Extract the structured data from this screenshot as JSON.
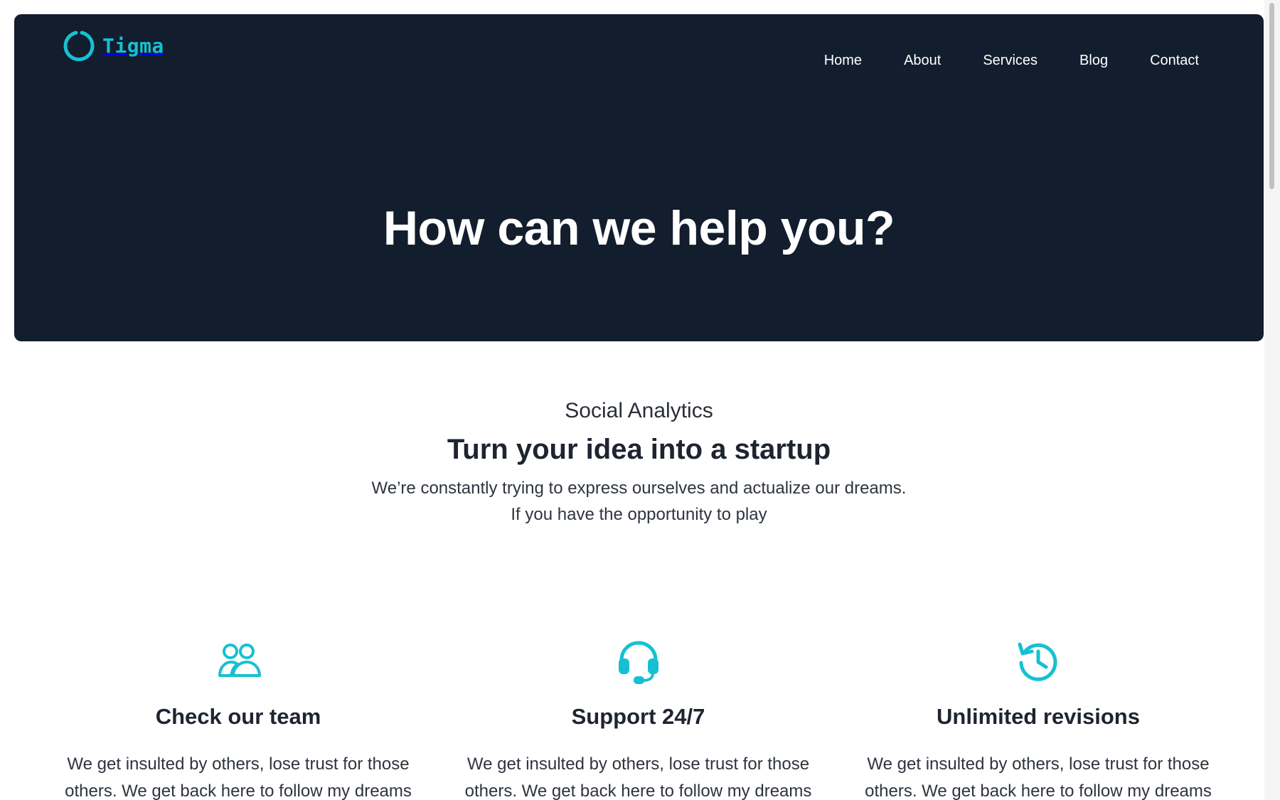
{
  "brand": {
    "name": "Tigma",
    "accent_color": "#16c0d2",
    "hero_bg_color": "#121d2d"
  },
  "nav": {
    "items": [
      {
        "label": "Home"
      },
      {
        "label": "About"
      },
      {
        "label": "Services"
      },
      {
        "label": "Blog"
      },
      {
        "label": "Contact"
      }
    ]
  },
  "hero": {
    "title": "How can we help you?"
  },
  "intro": {
    "eyebrow": "Social Analytics",
    "heading": "Turn your idea into a startup",
    "line1": "We’re constantly trying to express ourselves and actualize our dreams.",
    "line2": "If you have the opportunity to play"
  },
  "features": [
    {
      "icon": "users-icon",
      "title": "Check our team",
      "text_line1": "We get insulted by others, lose trust for those",
      "text_line2": "others. We get back here to follow my dreams"
    },
    {
      "icon": "headset-icon",
      "title": "Support 24/7",
      "text_line1": "We get insulted by others, lose trust for those",
      "text_line2": "others. We get back here to follow my dreams"
    },
    {
      "icon": "history-icon",
      "title": "Unlimited revisions",
      "text_line1": "We get insulted by others, lose trust for those",
      "text_line2": "others. We get back here to follow my dreams"
    }
  ]
}
